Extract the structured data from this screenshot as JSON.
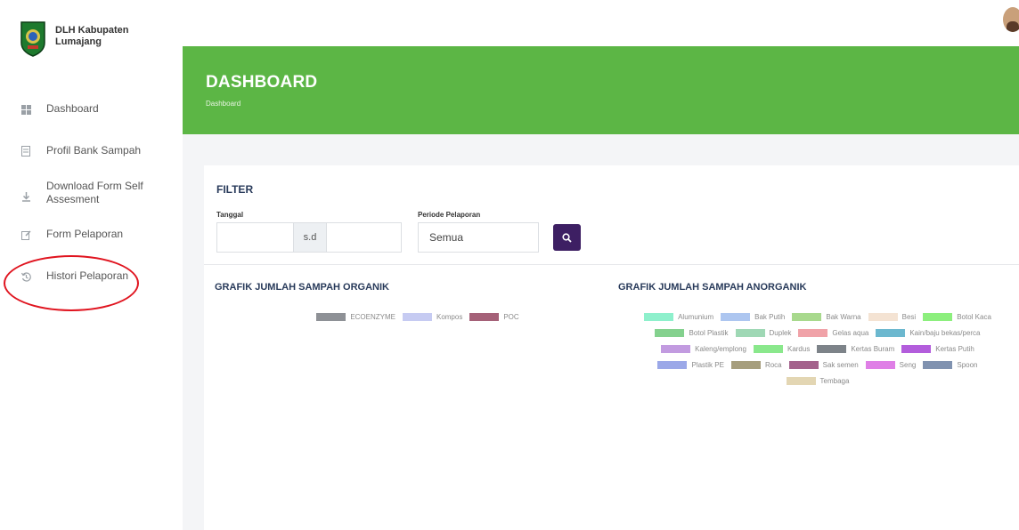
{
  "brand": {
    "name": "DLH Kabupaten Lumajang"
  },
  "sidebar": {
    "items": [
      {
        "label": "Dashboard",
        "icon": "dashboard-icon"
      },
      {
        "label": "Profil Bank Sampah",
        "icon": "document-icon"
      },
      {
        "label": "Download Form Self Assesment",
        "icon": "download-icon"
      },
      {
        "label": "Form Pelaporan",
        "icon": "edit-icon"
      },
      {
        "label": "Histori Pelaporan",
        "icon": "history-icon"
      }
    ]
  },
  "header": {
    "title": "DASHBOARD",
    "breadcrumb": "Dashboard",
    "color": "#5cb645"
  },
  "filter": {
    "title": "FILTER",
    "tanggal_label": "Tanggal",
    "date_separator": "s.d",
    "periode_label": "Periode Pelaporan",
    "periode_value": "Semua",
    "search_icon": "search-icon",
    "button_color": "#3d1f63"
  },
  "charts": {
    "organik": {
      "title": "GRAFIK JUMLAH SAMPAH ORGANIK",
      "legend": [
        {
          "name": "ECOENZYME",
          "color": "#8e9196"
        },
        {
          "name": "Kompos",
          "color": "#c6cbf2"
        },
        {
          "name": "POC",
          "color": "#a56178"
        }
      ]
    },
    "anorganik": {
      "title": "GRAFIK JUMLAH SAMPAH ANORGANIK",
      "legend": [
        {
          "name": "Alumunium",
          "color": "#8ef0cc"
        },
        {
          "name": "Bak Putih",
          "color": "#adc6f0"
        },
        {
          "name": "Bak Warna",
          "color": "#a8d98d"
        },
        {
          "name": "Besi",
          "color": "#f4e3d3"
        },
        {
          "name": "Botol Kaca",
          "color": "#8cef7d"
        },
        {
          "name": "Botol Plastik",
          "color": "#84d18e"
        },
        {
          "name": "Duplek",
          "color": "#9fd8b5"
        },
        {
          "name": "Gelas aqua",
          "color": "#f0a2a8"
        },
        {
          "name": "Kain/baju bekas/perca",
          "color": "#6cb8cf"
        },
        {
          "name": "Kaleng/emplong",
          "color": "#c29be0"
        },
        {
          "name": "Kardus",
          "color": "#8ae88c"
        },
        {
          "name": "Kertas Buram",
          "color": "#7d8389"
        },
        {
          "name": "Kertas Putih",
          "color": "#b35ddc"
        },
        {
          "name": "Plastik PE",
          "color": "#9ba8e8"
        },
        {
          "name": "Roca",
          "color": "#a69e7d"
        },
        {
          "name": "Sak semen",
          "color": "#a4628c"
        },
        {
          "name": "Seng",
          "color": "#df7fe6"
        },
        {
          "name": "Spoon",
          "color": "#8092b0"
        },
        {
          "name": "Tembaga",
          "color": "#e3d6b3"
        }
      ]
    }
  }
}
